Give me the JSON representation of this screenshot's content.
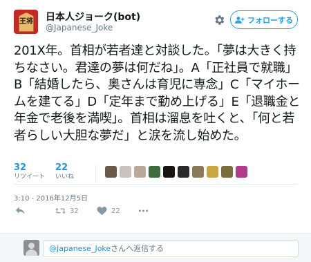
{
  "user": {
    "name": "日本人ジョーク(bot)",
    "handle": "@Japanese_Joke",
    "avatar_text": "王将"
  },
  "header": {
    "follow_label": "フォローする",
    "settings_icon": "gear-icon"
  },
  "tweet": {
    "text": "201X年。首相が若者達と対談した。「夢は大きく持ちなさい。君達の夢は何だね」。A「正社員で就職」B「結婚したら、奥さんは育児に専念」C「マイホームを建てる」D「定年まで勤め上げる」E「退職金と年金で老後を満喫」。首相は溜息を吐くと、「何と若者らしい大胆な夢だ」と涙を流し始めた。",
    "timestamp": "3:10 - 2016年12月5日"
  },
  "stats": {
    "retweets": {
      "count": "32",
      "label": "リツイート"
    },
    "likes": {
      "count": "22",
      "label": "いいね"
    },
    "liker_colors": [
      "#6b5a48",
      "#c9c2bb",
      "#b8a99a",
      "#3d6d3a",
      "#1a1410",
      "#2a2a2a",
      "#8a7a5a",
      "#caa640",
      "#7a6e3a",
      "#b03a8c"
    ]
  },
  "actions": {
    "retweet_count": "32",
    "like_count": "22"
  },
  "reply": {
    "mention": "@Japanese_Joke",
    "placeholder": "さんへ返信する"
  },
  "colors": {
    "accent": "#1da1f2",
    "link": "#1b95e0",
    "muted": "#657786"
  }
}
